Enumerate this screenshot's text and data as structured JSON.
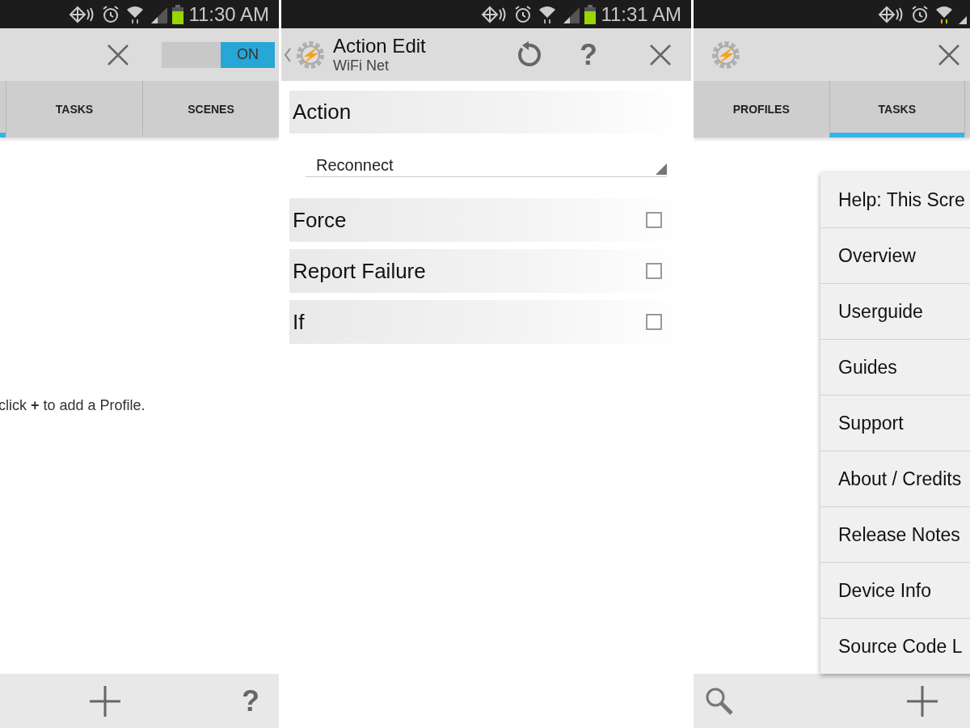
{
  "left_screen": {
    "status_bar": {
      "time": "11:30 AM"
    },
    "toggle": {
      "label": "ON",
      "on": true
    },
    "tabs": [
      {
        "selected": true
      },
      {
        "label": "TASKS",
        "selected": false
      },
      {
        "label": "SCENES",
        "selected": false
      }
    ],
    "empty_message": "click **+** to add a Profile.",
    "help": "?"
  },
  "middle_screen": {
    "status_bar": {
      "time": "11:31 AM"
    },
    "title": "Action Edit",
    "subtitle": "WiFi Net",
    "help": "?",
    "section": "Action",
    "dropdown": {
      "value": "Reconnect"
    },
    "options": [
      {
        "label": "Force",
        "checked": false
      },
      {
        "label": "Report Failure",
        "checked": false
      },
      {
        "label": "If",
        "checked": false
      }
    ]
  },
  "right_screen": {
    "tabs": [
      {
        "label": "PROFILES",
        "selected": false
      },
      {
        "label": "TASKS",
        "selected": true
      },
      {
        "selected": false
      }
    ],
    "menu": [
      "Help: This Scre",
      "Overview",
      "Userguide",
      "Guides",
      "Support",
      "About / Credits",
      "Release Notes",
      "Device Info",
      "Source Code L"
    ]
  }
}
